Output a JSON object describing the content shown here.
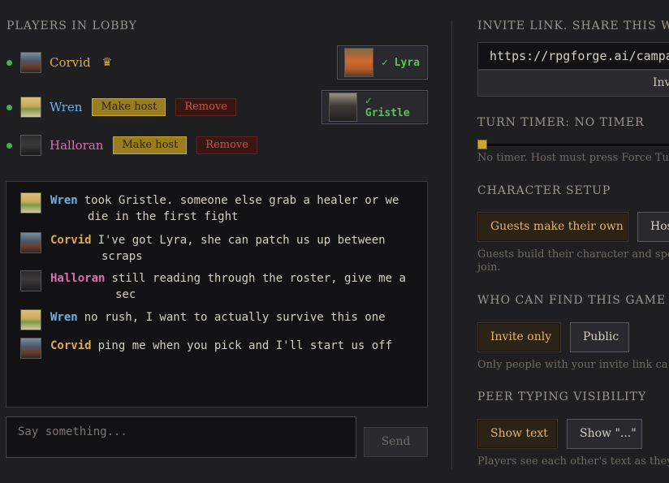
{
  "lobby": {
    "title": "PLAYERS IN LOBBY",
    "players": [
      {
        "name": "Corvid",
        "host_icon": "crown-icon",
        "crown": "♛"
      },
      {
        "name": "Wren",
        "make_host": "Make host",
        "remove": "Remove"
      },
      {
        "name": "Halloran",
        "make_host": "Make host",
        "remove": "Remove"
      }
    ],
    "claims": [
      {
        "label": "✓ Lyra"
      },
      {
        "label": "✓ Gristle"
      }
    ]
  },
  "chat": {
    "messages": [
      {
        "who": "Wren",
        "text": "took Gristle. someone else grab a healer or we die in the first fight"
      },
      {
        "who": "Corvid",
        "text": "I've got Lyra, she can patch us up between scraps"
      },
      {
        "who": "Halloran",
        "text": "still reading through the roster, give me a sec"
      },
      {
        "who": "Wren",
        "text": "no rush, I want to actually survive this one"
      },
      {
        "who": "Corvid",
        "text": "ping me when you pick and I'll start us off"
      }
    ],
    "placeholder": "Say something...",
    "send_label": "Send"
  },
  "settings": {
    "invite_title": "INVITE LINK. SHARE THIS WITH",
    "invite_url": "https://rpgforge.ai/campa",
    "invite_button": "Inv",
    "turn_title": "TURN TIMER: NO TIMER",
    "turn_help": "No timer. Host must press Force Tur",
    "turn_timer_value": 0,
    "char_title": "CHARACTER SETUP",
    "char_options": [
      "Guests make their own",
      "Hos"
    ],
    "char_help_1": "Guests build their character and spe",
    "char_help_2": "join.",
    "find_title": "WHO CAN FIND THIS GAME",
    "find_options": [
      "Invite only",
      "Public"
    ],
    "find_help": "Only people with your invite link ca",
    "typing_title": "PEER TYPING VISIBILITY",
    "typing_options": [
      "Show text",
      "Show \"...\""
    ],
    "typing_help": "Players see each other's text as they"
  },
  "colors": {
    "corvid": "#e0a94a",
    "wren": "#6fb1e8",
    "halloran": "#d86fb8",
    "accent_gold": "#c9a63a",
    "online_green": "#4caf50"
  }
}
